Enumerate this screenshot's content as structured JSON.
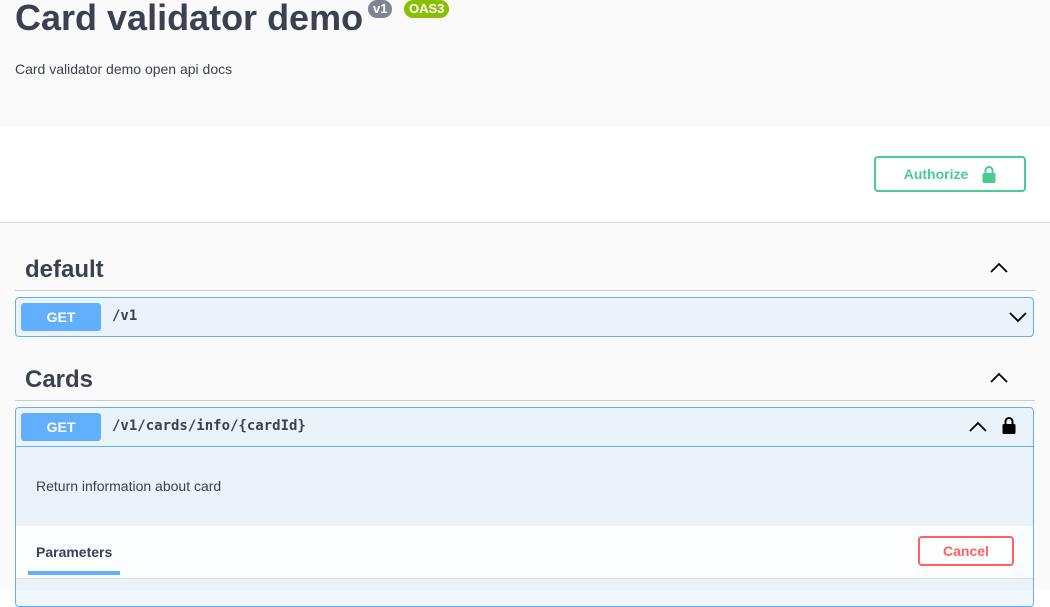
{
  "info": {
    "title": "Card validator demo",
    "version_badge": "v1",
    "oas_badge": "OAS3",
    "description": "Card validator demo open api docs"
  },
  "auth": {
    "button_label": "Authorize"
  },
  "tags": [
    {
      "name": "default",
      "operations": [
        {
          "method": "GET",
          "path": "/v1"
        }
      ]
    },
    {
      "name": "Cards",
      "operations": [
        {
          "method": "GET",
          "path": "/v1/cards/info/{cardId}",
          "description": "Return information about card",
          "params_tab": "Parameters",
          "cancel_label": "Cancel"
        }
      ]
    }
  ],
  "colors": {
    "get": "#61affe",
    "authorize": "#49cc90",
    "cancel": "#ff6060",
    "oas_badge": "#89bf04",
    "version_badge": "#7d8492"
  },
  "icons": [
    "lock-icon",
    "chevron-up-icon",
    "chevron-down-icon"
  ]
}
